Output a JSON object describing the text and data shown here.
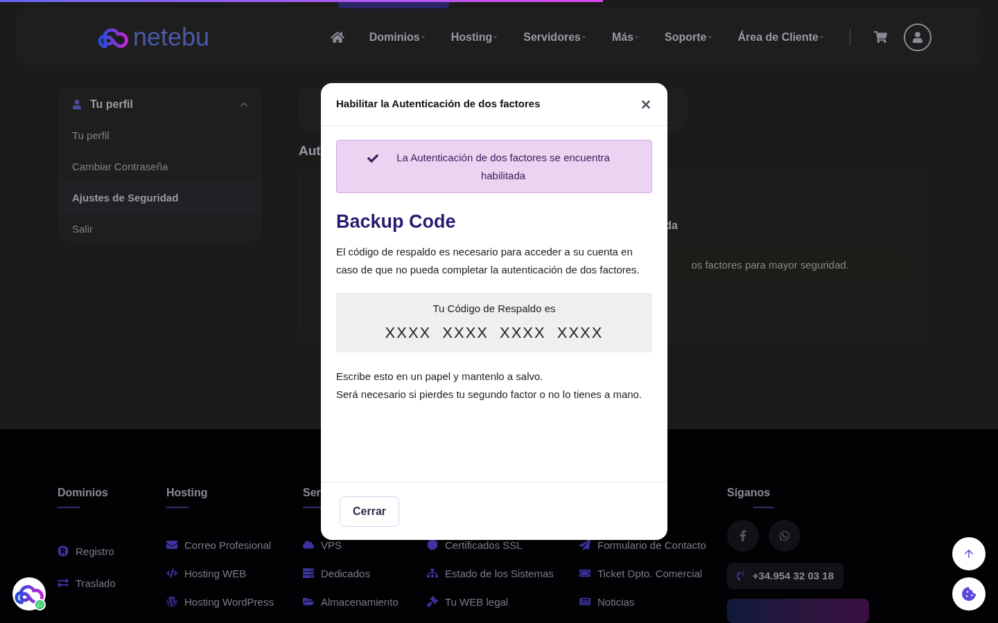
{
  "progress_bar": {
    "level": 0.604
  },
  "header": {
    "logo": "netebu",
    "nav": [
      {
        "label": "Dominios"
      },
      {
        "label": "Hosting"
      },
      {
        "label": "Servidores"
      },
      {
        "label": "Más"
      },
      {
        "label": "Soporte"
      },
      {
        "label": "Área de Cliente"
      }
    ]
  },
  "sidebar": {
    "title": "Tu perfil",
    "expanded": true,
    "items": [
      {
        "label": "Tu perfil",
        "selected": false
      },
      {
        "label": "Cambiar Contraseña",
        "selected": false
      },
      {
        "label": "Ajustes de Seguridad",
        "selected": true
      },
      {
        "label": "Salir",
        "selected": false
      }
    ]
  },
  "content": {
    "heading_fragment": "Aut",
    "subheading_fragment": "da",
    "notice_fragment": "os factores para mayor seguridad."
  },
  "footer": {
    "columns": [
      {
        "heading": "Dominios",
        "links": [
          "Registro",
          "Traslado"
        ]
      },
      {
        "heading": "Hosting",
        "links": [
          "Correo Profesional",
          "Hosting WEB",
          "Hosting WordPress"
        ]
      },
      {
        "heading": "Ser",
        "links": [
          "VPS",
          "Dedicados",
          "Almacenamiento"
        ]
      },
      {
        "links": [
          "Certificados SSL",
          "Estado de los Sistemas",
          "Tu WEB legal"
        ]
      },
      {
        "links": [
          "Formulario de Contacto",
          "Ticket Dpto. Comercial",
          "Noticias"
        ]
      }
    ],
    "follow": {
      "heading": "Síganos",
      "phone": "+34.954 32 03 18"
    }
  },
  "modal": {
    "title": "Habilitar la Autenticación de dos factores",
    "alert": {
      "kind": "success",
      "text": "La Autenticación de dos factores se encuentra habilitada"
    },
    "heading": "Backup Code",
    "description": "El código de respaldo es necesario para acceder a su cuenta en caso de que no pueda completar la autenticación de dos factores.",
    "code_label": "Tu Código de Respaldo es",
    "code_groups": [
      "XXXX",
      "XXXX",
      "XXXX",
      "XXXX"
    ],
    "notes": [
      "Escribe esto en un papel y mantenlo a salvo.",
      "Será necesario si pierdes tu segundo factor o no lo tienes a mano."
    ],
    "close_button": "Cerrar"
  }
}
